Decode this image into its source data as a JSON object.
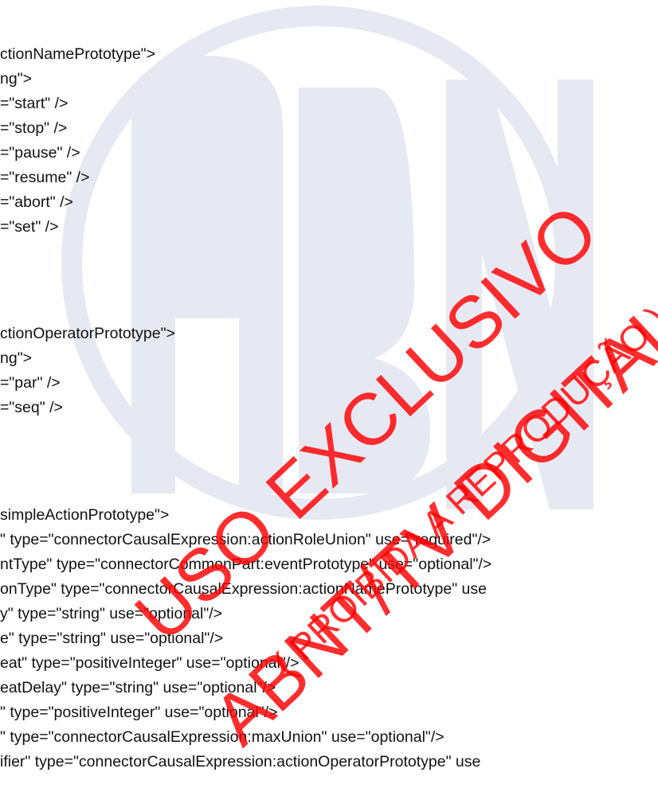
{
  "document": {
    "lines": [
      "ctionNamePrototype\">",
      "ng\">",
      "=\"start\" />",
      "=\"stop\" />",
      "=\"pause\" />",
      "=\"resume\" />",
      "=\"abort\" />",
      "=\"set\" />",
      "ctionOperatorPrototype\">",
      "ng\">",
      "=\"par\" />",
      "=\"seq\" />",
      "simpleActionPrototype\">",
      "\" type=\"connectorCausalExpression:actionRoleUnion\" use=\"required\"/>",
      "ntType\" type=\"connectorCommonPart:eventPrototype\" use=\"optional\"/>",
      "onType\" type=\"connectorCausalExpression:actionNamePrototype\" use",
      "y\" type=\"string\" use=\"optional\"/>",
      "e\" type=\"string\" use=\"optional\"/>",
      "eat\" type=\"positiveInteger\" use=\"optional\"/>",
      "eatDelay\" type=\"string\" use=\"optional\"/>",
      "\" type=\"positiveInteger\" use=\"optional\"/>",
      "\" type=\"connectorCausalExpression:maxUnion\" use=\"optional\"/>",
      "ifier\" type=\"connectorCausalExpression:actionOperatorPrototype\" use"
    ]
  },
  "watermark": {
    "line1": "USO EXCLUSIVO",
    "line2": "ABNT/TV DIGITAL",
    "line3": "( PROIBIDA A REPRODUÇÃO )",
    "color": "#ff0000"
  },
  "logo": {
    "color": "#e6e9f2"
  }
}
